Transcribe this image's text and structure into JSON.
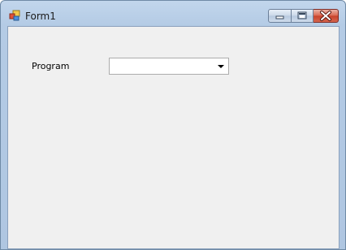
{
  "window": {
    "title": "Form1"
  },
  "form": {
    "program_label": "Program",
    "program_value": ""
  },
  "icons": {
    "app": "form-app-icon",
    "minimize": "minimize-icon",
    "maximize": "maximize-icon",
    "close": "close-icon",
    "dropdown": "chevron-down-icon"
  },
  "colors": {
    "close_button": "#c7402a",
    "client_background": "#f0f0f0",
    "title_gradient": "#b4cbe5"
  }
}
